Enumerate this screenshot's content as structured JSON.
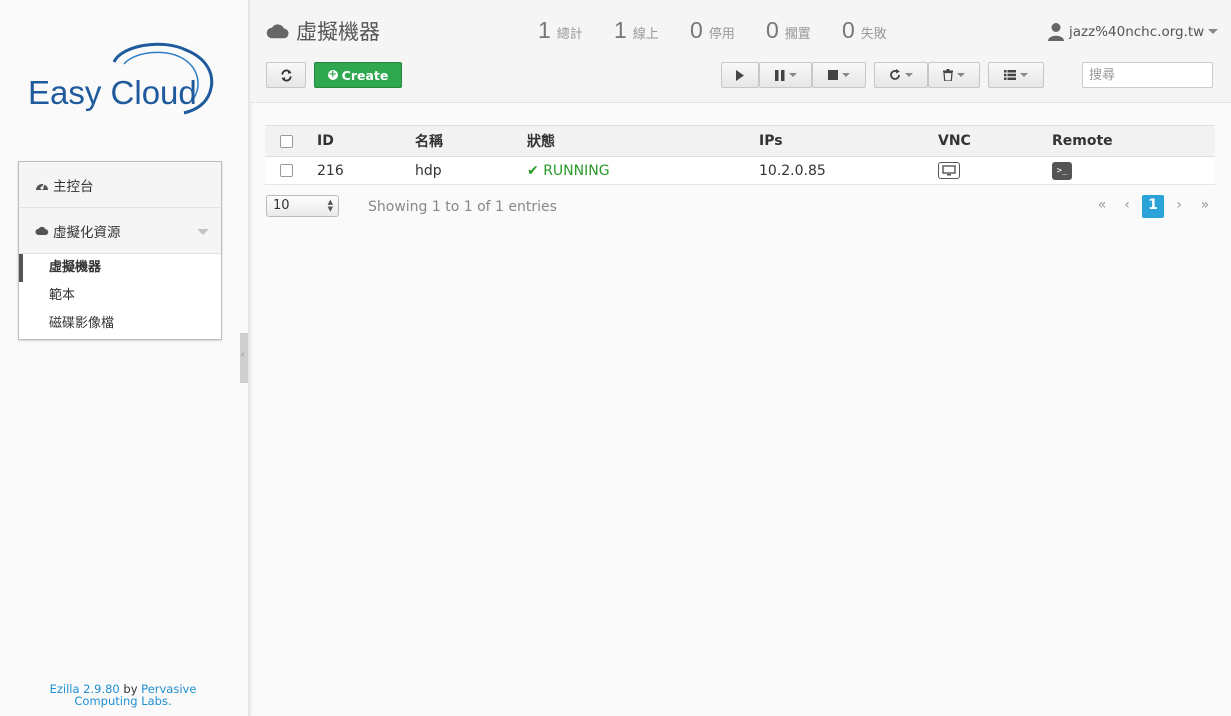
{
  "brand": {
    "logo_text": "Easy Cloud"
  },
  "sidebar": {
    "menu": [
      {
        "label": "主控台",
        "icon": "dashboard-icon"
      },
      {
        "label": "虛擬化資源",
        "icon": "cloud-icon",
        "expanded": true
      }
    ],
    "sub_items": [
      {
        "label": "虛擬機器",
        "active": true
      },
      {
        "label": "範本",
        "active": false
      },
      {
        "label": "磁碟影像檔",
        "active": false
      }
    ],
    "footer": {
      "version": "Ezilla 2.9.80",
      "by": "by",
      "org": "Pervasive Computing Labs."
    }
  },
  "header": {
    "title": "虛擬機器",
    "stats": [
      {
        "num": "1",
        "label": "總計"
      },
      {
        "num": "1",
        "label": "線上"
      },
      {
        "num": "0",
        "label": "停用"
      },
      {
        "num": "0",
        "label": "擱置"
      },
      {
        "num": "0",
        "label": "失敗"
      }
    ],
    "user": "jazz%40nchc.org.tw",
    "create_label": "Create",
    "search_placeholder": "搜尋"
  },
  "table": {
    "columns": [
      "ID",
      "名稱",
      "狀態",
      "IPs",
      "VNC",
      "Remote"
    ],
    "rows": [
      {
        "id": "216",
        "name": "hdp",
        "status": "RUNNING",
        "ip": "10.2.0.85"
      }
    ]
  },
  "pagination": {
    "page_size": "10",
    "info": "Showing 1 to 1 of 1 entries",
    "first": "«",
    "prev": "‹",
    "current": "1",
    "next": "›",
    "last": "»"
  },
  "colors": {
    "accent": "#29a3d8",
    "create": "#2fa84f",
    "running": "#2a9a2a",
    "logo": "#1e5a9c"
  }
}
